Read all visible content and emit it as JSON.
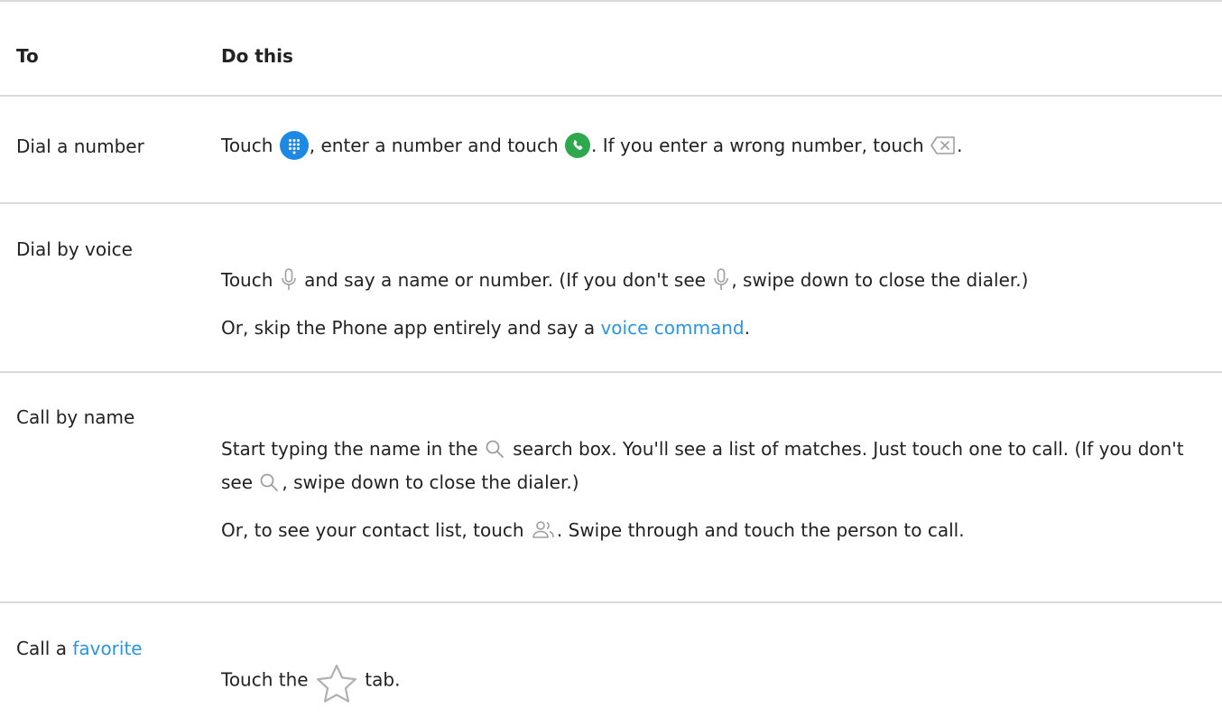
{
  "header": {
    "to": "To",
    "do": "Do this"
  },
  "rows": [
    {
      "to": "Dial a number",
      "do": {
        "t1": "Touch ",
        "t2": ", enter a number and touch ",
        "t3": ". If you enter a wrong number, touch ",
        "t4": "."
      }
    },
    {
      "to": "Dial by voice",
      "do": {
        "p1a": "Touch ",
        "p1b": " and say a name or number. (If you don't see ",
        "p1c": ", swipe down to close the dialer.)",
        "p2a": "Or, skip the Phone app entirely and say a ",
        "p2link": "voice command",
        "p2b": "."
      }
    },
    {
      "to": "Call by name",
      "do": {
        "p1a": "Start typing the name in the ",
        "p1b": " search box. You'll see a list of matches. Just touch one to call. (If you don't see ",
        "p1c": ", swipe down to close the dialer.)",
        "p2a": "Or, to see your contact list, touch ",
        "p2b": ". Swipe through and touch the person to call."
      }
    },
    {
      "to_prefix": "Call a ",
      "to_link": "favorite",
      "do": {
        "a": "Touch the ",
        "b": " tab."
      }
    }
  ],
  "icons": {
    "dialpad": "dialpad-icon",
    "call": "call-icon",
    "backspace": "backspace-icon",
    "mic": "microphone-icon",
    "search": "search-icon",
    "contacts": "contacts-icon",
    "star": "star-icon"
  },
  "colors": {
    "link": "#2b96e0",
    "dialpad_blue": "#1e88e5",
    "call_green": "#2ea84d",
    "divider": "#dadada",
    "icon_gray": "#9e9e9e"
  }
}
